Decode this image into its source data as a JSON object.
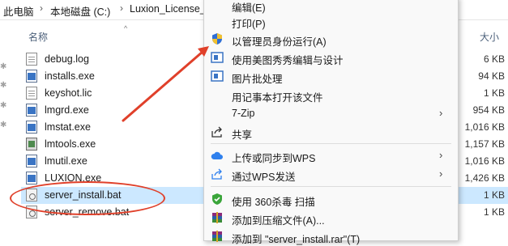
{
  "breadcrumb": [
    "此电脑",
    "本地磁盘 (C:)",
    "Luxion_License_"
  ],
  "columns": {
    "name": "名称",
    "size": "大小"
  },
  "files": [
    {
      "name": "debug.log",
      "size": "6 KB",
      "icon": "text-file-icon"
    },
    {
      "name": "installs.exe",
      "size": "94 KB",
      "icon": "exe-file-icon"
    },
    {
      "name": "keyshot.lic",
      "size": "1 KB",
      "icon": "text-file-icon"
    },
    {
      "name": "lmgrd.exe",
      "size": "954 KB",
      "icon": "exe-file-icon"
    },
    {
      "name": "lmstat.exe",
      "size": "1,016 KB",
      "icon": "exe-file-icon"
    },
    {
      "name": "lmtools.exe",
      "size": "1,157 KB",
      "icon": "tools-file-icon"
    },
    {
      "name": "lmutil.exe",
      "size": "1,016 KB",
      "icon": "exe-file-icon"
    },
    {
      "name": "LUXION.exe",
      "size": "1,426 KB",
      "icon": "exe-file-icon"
    },
    {
      "name": "server_install.bat",
      "size": "1 KB",
      "icon": "batch-file-icon",
      "selected": true
    },
    {
      "name": "server_remove.bat",
      "size": "1 KB",
      "icon": "batch-file-icon"
    }
  ],
  "menu": {
    "items": [
      {
        "label": "编辑(E)"
      },
      {
        "label": "打印(P)"
      },
      {
        "label": "以管理员身份运行(A)",
        "icon": "shield-icon"
      },
      {
        "label": "使用美图秀秀编辑与设计",
        "icon": "app-icon"
      },
      {
        "label": "图片批处理",
        "icon": "app-icon"
      },
      {
        "label": "用记事本打开该文件"
      },
      {
        "label": "7-Zip",
        "submenu": true
      },
      {
        "label": "共享",
        "icon": "share-icon"
      },
      {
        "label": "上传或同步到WPS",
        "icon": "cloud-icon",
        "submenu": true
      },
      {
        "label": "通过WPS发送",
        "icon": "send-icon",
        "submenu": true
      },
      {
        "label": "使用 360杀毒 扫描",
        "icon": "antivirus-icon"
      },
      {
        "label": "添加到压缩文件(A)...",
        "icon": "archive-icon"
      },
      {
        "label": "添加到 \"server_install.rar\"(T)",
        "icon": "archive-icon"
      }
    ]
  },
  "colors": {
    "accent": "#e0402a",
    "selection": "#cce8ff",
    "menu_bg": "#f9f9f9"
  }
}
